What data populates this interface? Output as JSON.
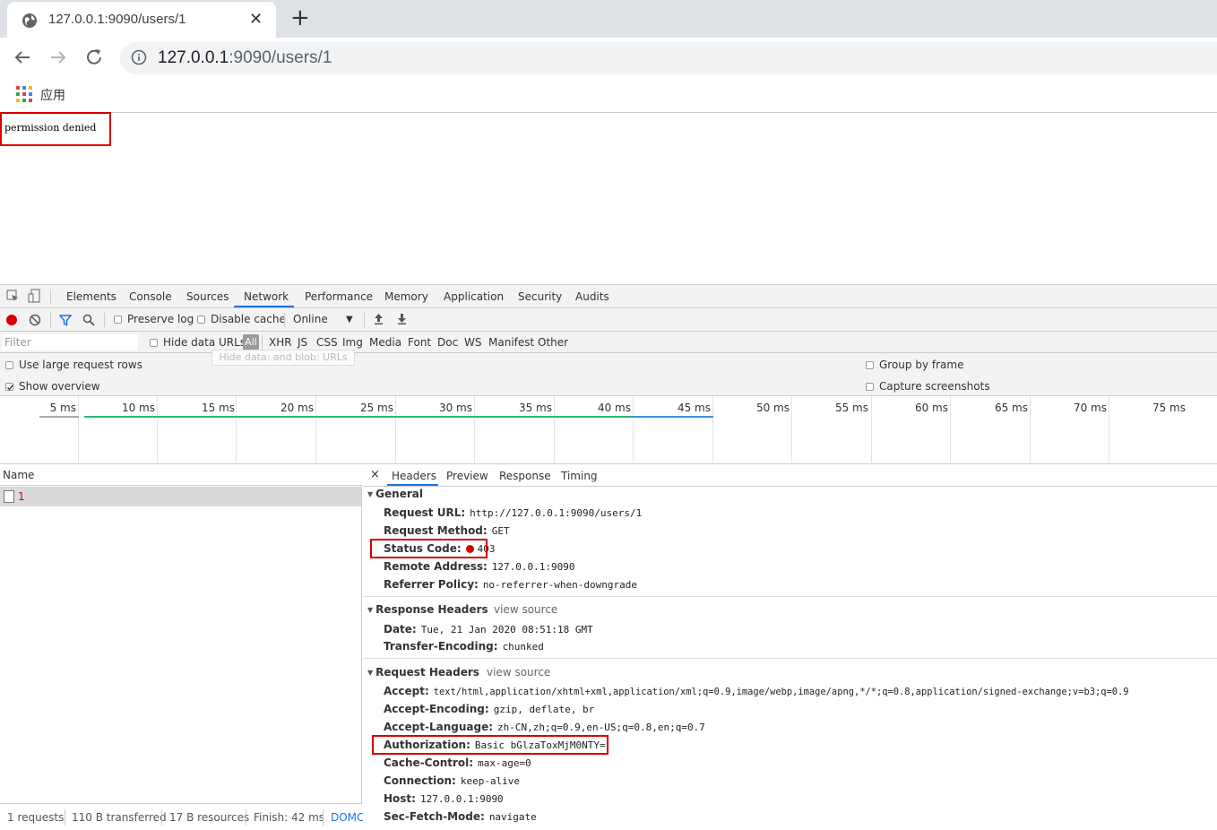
{
  "browser": {
    "tab_title": "127.0.0.1:9090/users/1",
    "tab_close": "✕",
    "new_tab": "+",
    "url_host": "127.0.0.1",
    "url_rest": ":9090/users/1",
    "bookmarks_apps_label": "应用"
  },
  "page": {
    "body_text": "permission denied"
  },
  "devtools": {
    "tabs": [
      "Elements",
      "Console",
      "Sources",
      "Network",
      "Performance",
      "Memory",
      "Application",
      "Security",
      "Audits"
    ],
    "active_tab": "Network",
    "toolbar": {
      "preserve_log": "Preserve log",
      "disable_cache": "Disable cache",
      "throttle": "Online"
    },
    "filter": {
      "placeholder": "Filter",
      "hide_data_urls": "Hide data URLs",
      "types": [
        "All",
        "XHR",
        "JS",
        "CSS",
        "Img",
        "Media",
        "Font",
        "Doc",
        "WS",
        "Manifest",
        "Other"
      ],
      "tooltip": "Hide data: and blob: URLs"
    },
    "options": {
      "large_rows": "Use large request rows",
      "show_overview": "Show overview",
      "group_by_frame": "Group by frame",
      "capture_screenshots": "Capture screenshots"
    },
    "timeline_ticks": [
      "5 ms",
      "10 ms",
      "15 ms",
      "20 ms",
      "25 ms",
      "30 ms",
      "35 ms",
      "40 ms",
      "45 ms",
      "50 ms",
      "55 ms",
      "60 ms",
      "65 ms",
      "70 ms",
      "75 ms"
    ],
    "name_column": "Name",
    "request_name": "1",
    "status_bar": {
      "requests": "1 requests",
      "transferred": "110 B transferred",
      "resources": "17 B resources",
      "finish": "Finish: 42 ms",
      "domc": "DOMC"
    },
    "detail_tabs": [
      "Headers",
      "Preview",
      "Response",
      "Timing"
    ],
    "close_glyph": "×",
    "general": {
      "title": "General",
      "request_url_k": "Request URL:",
      "request_url_v": "http://127.0.0.1:9090/users/1",
      "request_method_k": "Request Method:",
      "request_method_v": "GET",
      "status_code_k": "Status Code:",
      "status_code_v": "403",
      "remote_address_k": "Remote Address:",
      "remote_address_v": "127.0.0.1:9090",
      "referrer_policy_k": "Referrer Policy:",
      "referrer_policy_v": "no-referrer-when-downgrade"
    },
    "response_headers": {
      "title": "Response Headers",
      "view_source": "view source",
      "date_k": "Date:",
      "date_v": "Tue, 21 Jan 2020 08:51:18 GMT",
      "te_k": "Transfer-Encoding:",
      "te_v": "chunked"
    },
    "request_headers": {
      "title": "Request Headers",
      "view_source": "view source",
      "accept_k": "Accept:",
      "accept_v": "text/html,application/xhtml+xml,application/xml;q=0.9,image/webp,image/apng,*/*;q=0.8,application/signed-exchange;v=b3;q=0.9",
      "ae_k": "Accept-Encoding:",
      "ae_v": "gzip, deflate, br",
      "al_k": "Accept-Language:",
      "al_v": "zh-CN,zh;q=0.9,en-US;q=0.8,en;q=0.7",
      "auth_k": "Authorization:",
      "auth_v": "Basic bGlzaToxMjM0NTY=",
      "cc_k": "Cache-Control:",
      "cc_v": "max-age=0",
      "conn_k": "Connection:",
      "conn_v": "keep-alive",
      "host_k": "Host:",
      "host_v": "127.0.0.1:9090",
      "sfm_k": "Sec-Fetch-Mode:",
      "sfm_v": "navigate"
    }
  },
  "colors": {
    "highlight_red": "#d60000",
    "accent_blue": "#1a73e8",
    "timeline_green": "#2eb873"
  }
}
